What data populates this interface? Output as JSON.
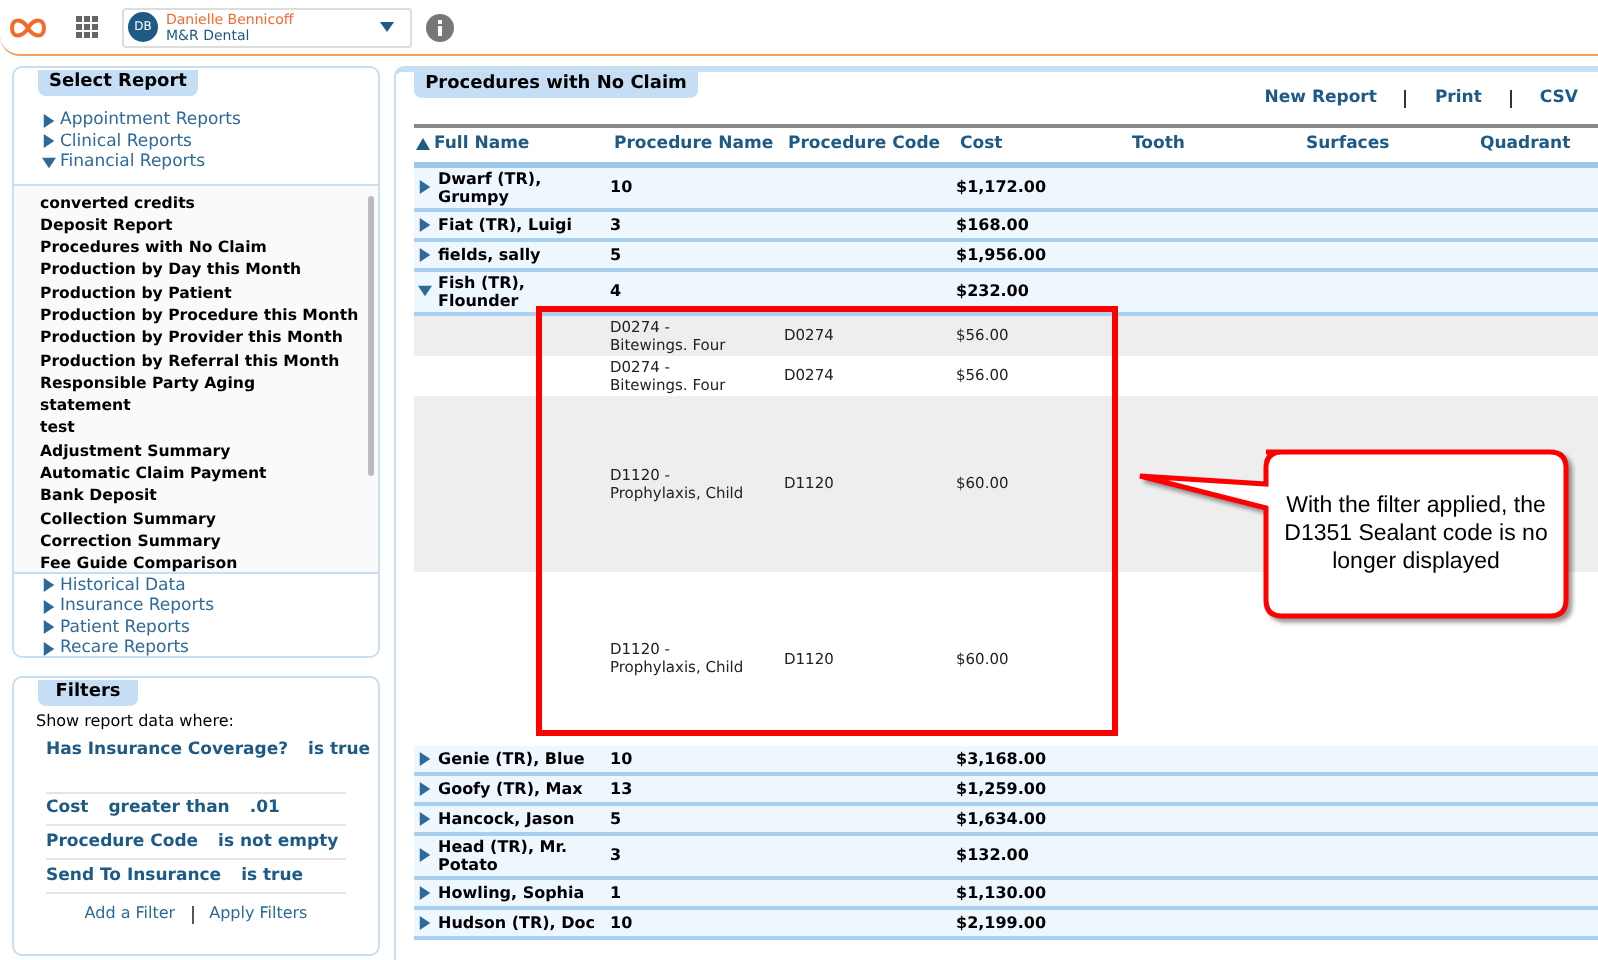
{
  "header": {
    "user": {
      "initials": "DB",
      "name": "Danielle Bennicoff",
      "practice": "M&R Dental"
    }
  },
  "select_report": {
    "title": "Select Report",
    "groups_top": [
      {
        "label": "Appointment Reports",
        "expanded": false
      },
      {
        "label": "Clinical Reports",
        "expanded": false
      },
      {
        "label": "Financial Reports",
        "expanded": true
      }
    ],
    "reports": [
      "converted credits",
      "Deposit Report",
      "Procedures with No Claim",
      "Production by Day this Month",
      "Production by Patient",
      "Production by Procedure this Month",
      "Production by Provider this Month",
      "Production by Referral this Month",
      "Responsible Party Aging",
      "statement",
      "test",
      "Adjustment Summary",
      "Automatic Claim Payment",
      "Bank Deposit",
      "Collection Summary",
      "Correction Summary",
      "Fee Guide Comparison"
    ],
    "groups_bottom": [
      {
        "label": "Historical Data",
        "expanded": false
      },
      {
        "label": "Insurance Reports",
        "expanded": false
      },
      {
        "label": "Patient Reports",
        "expanded": false
      },
      {
        "label": "Recare Reports",
        "expanded": false
      }
    ]
  },
  "filters": {
    "title": "Filters",
    "intro": "Show report data where:",
    "conditions": [
      {
        "field": "Has Insurance Coverage?",
        "operator": "is true"
      },
      {
        "field": "Cost",
        "operator": "greater than",
        "value": ".01"
      },
      {
        "field": "Procedure Code",
        "operator": "is not empty"
      },
      {
        "field": "Send To Insurance",
        "operator": "is true"
      }
    ],
    "actions": [
      "Add a Filter",
      "Apply Filters"
    ]
  },
  "report": {
    "title": "Procedures with No Claim",
    "actions": [
      "New Report",
      "Print",
      "CSV"
    ],
    "columns": [
      {
        "label": "Full Name",
        "sorted": true
      },
      {
        "label": "Procedure Name",
        "sorted": false
      },
      {
        "label": "Procedure Code",
        "sorted": false
      },
      {
        "label": "Cost",
        "sorted": false
      },
      {
        "label": "Tooth",
        "sorted": false
      },
      {
        "label": "Surfaces",
        "sorted": false
      },
      {
        "label": "Quadrant",
        "sorted": false
      }
    ],
    "rows": [
      {
        "name": "Dwarf (TR), Grumpy",
        "count": "10",
        "cost": "$1,172.00",
        "expanded": false
      },
      {
        "name": "Fiat (TR), Luigi",
        "count": "3",
        "cost": "$168.00",
        "expanded": false
      },
      {
        "name": "fields, sally",
        "count": "5",
        "cost": "$1,956.00",
        "expanded": false
      },
      {
        "name": "Fish (TR), Flounder",
        "count": "4",
        "cost": "$232.00",
        "expanded": true,
        "details": [
          {
            "procedure_name": "D0274 - Bitewings. Four",
            "procedure_code": "D0274",
            "cost": "$56.00"
          },
          {
            "procedure_name": "D0274 - Bitewings. Four",
            "procedure_code": "D0274",
            "cost": "$56.00"
          },
          {
            "procedure_name": "D1120 - Prophylaxis, Child",
            "procedure_code": "D1120",
            "cost": "$60.00"
          },
          {
            "procedure_name": "D1120 - Prophylaxis, Child",
            "procedure_code": "D1120",
            "cost": "$60.00"
          }
        ]
      },
      {
        "name": "Genie (TR), Blue",
        "count": "10",
        "cost": "$3,168.00",
        "expanded": false
      },
      {
        "name": "Goofy (TR), Max",
        "count": "13",
        "cost": "$1,259.00",
        "expanded": false
      },
      {
        "name": "Hancock, Jason",
        "count": "5",
        "cost": "$1,634.00",
        "expanded": false
      },
      {
        "name": "Head (TR), Mr. Potato",
        "count": "3",
        "cost": "$132.00",
        "expanded": false
      },
      {
        "name": "Howling, Sophia",
        "count": "1",
        "cost": "$1,130.00",
        "expanded": false
      },
      {
        "name": "Hudson (TR), Doc",
        "count": "10",
        "cost": "$2,199.00",
        "expanded": false
      }
    ]
  },
  "callout": {
    "text": "With the filter applied, the D1351 Sealant code is no longer displayed"
  }
}
